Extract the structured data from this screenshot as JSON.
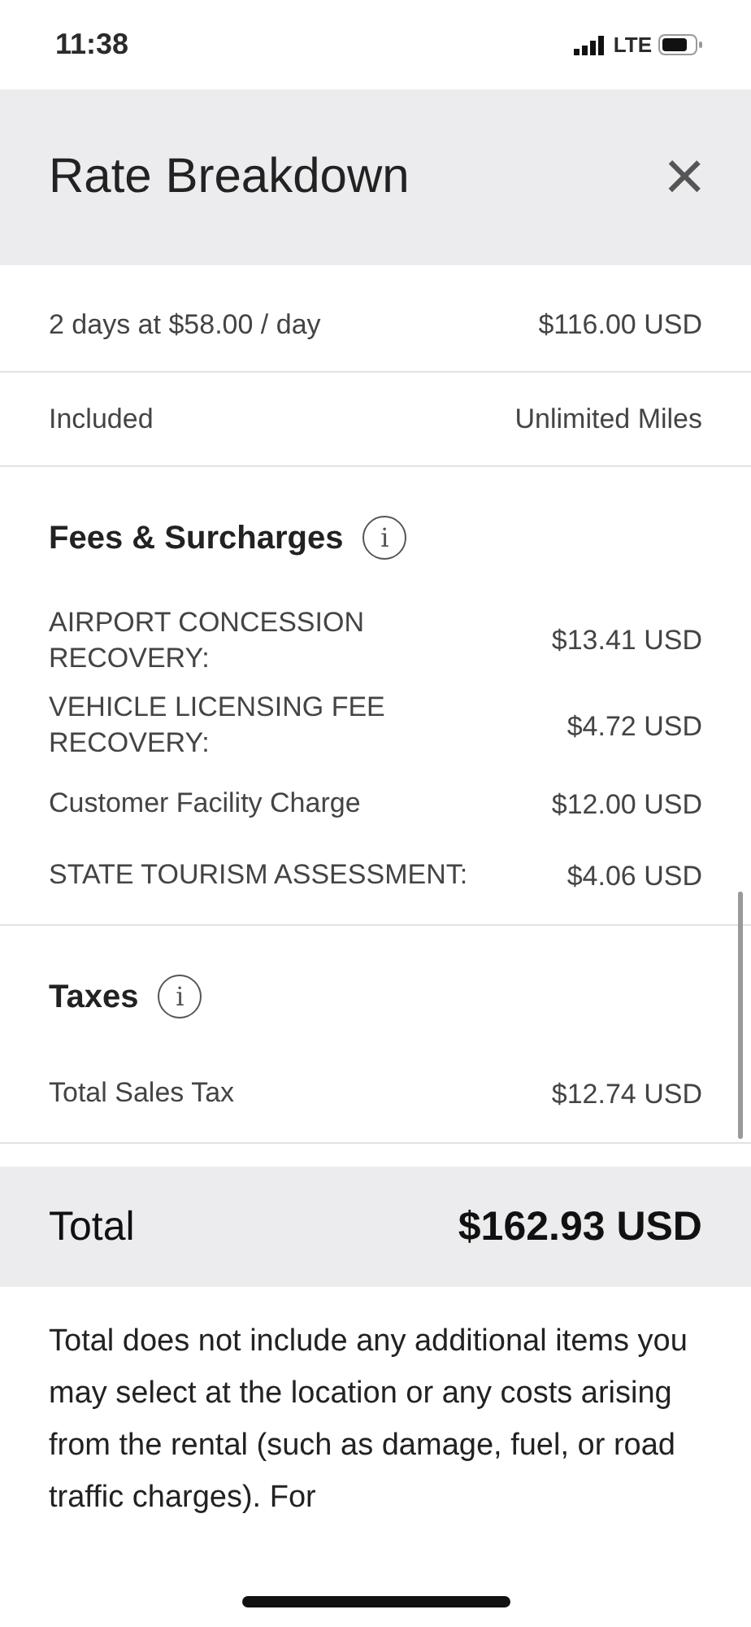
{
  "status_bar": {
    "time": "11:38",
    "network": "LTE"
  },
  "header": {
    "title": "Rate Breakdown",
    "close": "×"
  },
  "summary": [
    {
      "label": "2 days at $58.00 / day",
      "value": "$116.00 USD"
    },
    {
      "label": "Included",
      "value": "Unlimited Miles"
    }
  ],
  "sections": [
    {
      "title": "Fees & Surcharges",
      "info": "i",
      "items": [
        {
          "label": "AIRPORT CONCESSION RECOVERY:",
          "value": "$13.41 USD"
        },
        {
          "label": "VEHICLE LICENSING FEE RECOVERY:",
          "value": "$4.72 USD"
        },
        {
          "label": "Customer Facility Charge",
          "value": "$12.00 USD"
        },
        {
          "label": "STATE TOURISM ASSESSMENT:",
          "value": "$4.06 USD"
        }
      ]
    },
    {
      "title": "Taxes",
      "info": "i",
      "items": [
        {
          "label": "Total Sales Tax",
          "value": "$12.74 USD"
        }
      ]
    }
  ],
  "total": {
    "label": "Total",
    "value": "$162.93 USD"
  },
  "disclaimer": "Total does not include any additional items you may select at the location or any costs arising from the rental (such as damage, fuel, or road traffic charges). For"
}
